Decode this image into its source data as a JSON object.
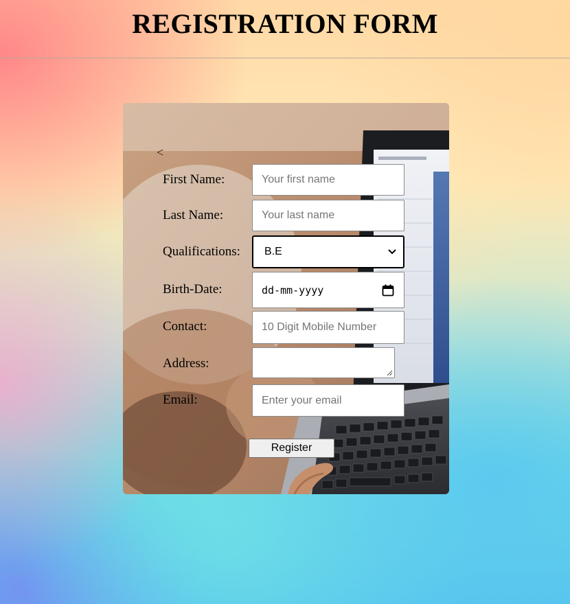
{
  "header": {
    "title": "REGISTRATION FORM"
  },
  "form": {
    "back_glyph": "<",
    "first_name": {
      "label": "First Name:",
      "placeholder": "Your first name"
    },
    "last_name": {
      "label": "Last Name:",
      "placeholder": "Your last name"
    },
    "qualifications": {
      "label": "Qualifications:",
      "selected": "B.E"
    },
    "birth_date": {
      "label": "Birth-Date:",
      "placeholder": "dd-mm-yyyy"
    },
    "contact": {
      "label": "Contact:",
      "placeholder": "10 Digit Mobile Number"
    },
    "address": {
      "label": "Address:",
      "value": ""
    },
    "email": {
      "label": "Email:",
      "placeholder": "Enter your email"
    },
    "register_label": "Register"
  },
  "icons": {
    "select_arrow": "chevron-down-icon",
    "date_picker": "calendar-icon",
    "background": "laptop-photo"
  }
}
